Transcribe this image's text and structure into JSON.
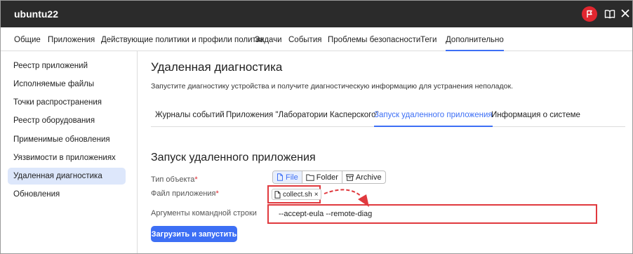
{
  "window": {
    "title": "ubuntu22"
  },
  "topnav": {
    "tabs": [
      {
        "label": "Общие"
      },
      {
        "label": "Приложения"
      },
      {
        "label": "Действующие политики и профили политик"
      },
      {
        "label": "Задачи"
      },
      {
        "label": "События"
      },
      {
        "label": "Проблемы безопасности"
      },
      {
        "label": "Теги"
      },
      {
        "label": "Дополнительно",
        "active": true
      }
    ]
  },
  "sidebar": {
    "items": [
      {
        "label": "Реестр приложений"
      },
      {
        "label": "Исполняемые файлы"
      },
      {
        "label": "Точки распространения"
      },
      {
        "label": "Реестр оборудования"
      },
      {
        "label": "Применимые обновления"
      },
      {
        "label": "Уязвимости в приложениях"
      },
      {
        "label": "Удаленная диагностика",
        "active": true
      },
      {
        "label": "Обновления"
      }
    ]
  },
  "main": {
    "title": "Удаленная диагностика",
    "description": "Запустите диагностику устройства и получите диагностическую информацию для устранения неполадок.",
    "subtabs": [
      {
        "label": "Журналы событий"
      },
      {
        "label": "Приложения \"Лаборатории Касперского\""
      },
      {
        "label": "Запуск удаленного приложения",
        "active": true
      },
      {
        "label": "Информация о системе"
      }
    ],
    "section_title": "Запуск удаленного приложения",
    "object_type": {
      "label": "Тип объекта",
      "required_mark": "*",
      "options": [
        "File",
        "Folder",
        "Archive"
      ],
      "selected": "File"
    },
    "app_file": {
      "label": "Файл приложения",
      "required_mark": "*",
      "file_name": "collect.sh",
      "remove_glyph": "×"
    },
    "args": {
      "label": "Аргументы командной строки",
      "value": "--accept-eula --remote-diag"
    },
    "run_button": "Загрузить и запустить"
  },
  "colors": {
    "accent": "#3d6ff5",
    "highlight": "#e0393e",
    "titlebar": "#2b2b2b",
    "active_bg": "#dde7fb"
  }
}
